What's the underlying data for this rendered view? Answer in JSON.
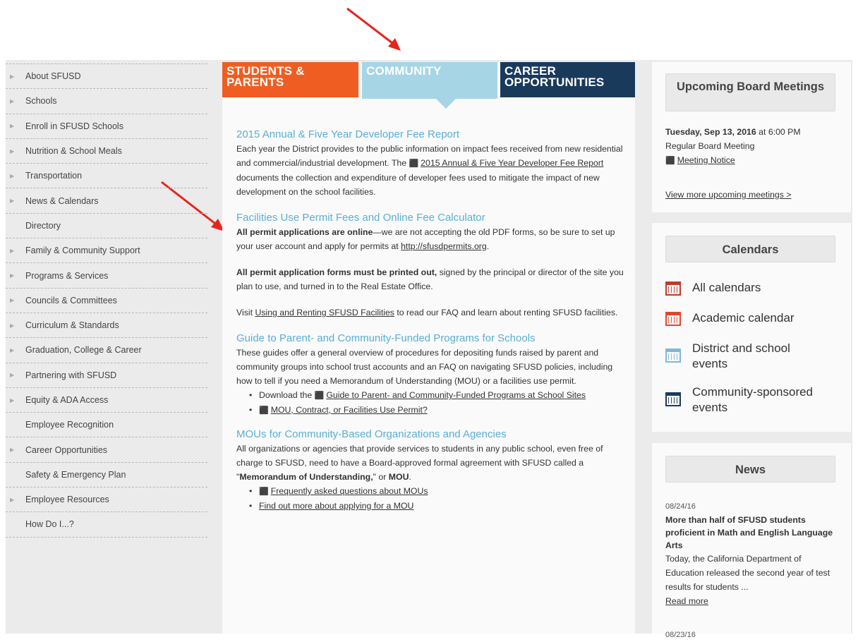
{
  "nav": {
    "items": [
      {
        "label": "About SFUSD",
        "arrow": true
      },
      {
        "label": "Schools",
        "arrow": true
      },
      {
        "label": "Enroll in SFUSD Schools",
        "arrow": true
      },
      {
        "label": "Nutrition & School Meals",
        "arrow": true
      },
      {
        "label": "Transportation",
        "arrow": true
      },
      {
        "label": "News & Calendars",
        "arrow": true
      },
      {
        "label": "Directory",
        "arrow": false
      },
      {
        "label": "Family & Community Support",
        "arrow": true
      },
      {
        "label": "Programs & Services",
        "arrow": true
      },
      {
        "label": "Councils & Committees",
        "arrow": true
      },
      {
        "label": "Curriculum & Standards",
        "arrow": true
      },
      {
        "label": "Graduation, College & Career",
        "arrow": true
      },
      {
        "label": "Partnering with SFUSD",
        "arrow": true
      },
      {
        "label": "Equity & ADA Access",
        "arrow": true
      },
      {
        "label": "Employee Recognition",
        "arrow": false
      },
      {
        "label": "Career Opportunities",
        "arrow": true
      },
      {
        "label": "Safety & Emergency Plan",
        "arrow": false
      },
      {
        "label": "Employee Resources",
        "arrow": true
      },
      {
        "label": "How Do I...?",
        "arrow": false
      }
    ]
  },
  "tabs": {
    "students_line1": "STUDENTS &",
    "students_line2": "PARENTS",
    "community": "COMMUNITY",
    "career_line1": "CAREER",
    "career_line2": "OPPORTUNITIES"
  },
  "content": {
    "s1_title": "2015 Annual & Five Year Developer Fee Report",
    "s1_t1": "Each year the District provides to the public information on impact fees received from new residential and commercial/industrial development. The ",
    "s1_link": "2015 Annual & Five Year Developer Fee Report",
    "s1_t2": " documents the collection and expenditure of developer fees used to mitigate the impact of new development on the school facilities.",
    "s2_title": "Facilities Use Permit Fees and Online Fee Calculator",
    "s2_p1_bold": "All permit applications are online",
    "s2_p1_text": "—we are not accepting the old PDF forms, so be sure to set up your user account and apply for permits at ",
    "s2_p1_link": "http://sfusdpermits.org",
    "s2_p1_end": ".",
    "s2_p2_bold": "All permit application forms must be printed out,",
    "s2_p2_text": " signed by the principal or director of the site you plan to use, and turned in to the Real Estate Office.",
    "s2_p3_a": "Visit ",
    "s2_p3_link": "Using and Renting SFUSD Facilities",
    "s2_p3_b": " to read our FAQ and learn about renting SFUSD facilities.",
    "s3_title": "Guide to Parent- and Community-Funded Programs for Schools",
    "s3_text": "These guides offer a general overview of procedures for depositing funds raised by parent and community groups into school trust accounts and an FAQ on navigating SFUSD policies, including how to tell if you need a Memorandum of Understanding (MOU) or a facilities use permit.",
    "s3_b1_pre": "Download the ",
    "s3_b1_link": "Guide to Parent- and Community-Funded Programs at School Sites",
    "s3_b2_link": "MOU, Contract, or Facilities Use Permit?",
    "s4_title": "MOUs for Community-Based Organizations and Agencies",
    "s4_t1": "All organizations or agencies that provide services to students in any public school, even free of charge to SFUSD, need to have a Board-approved formal agreement with SFUSD called a \"",
    "s4_b1": "Memorandum of Understanding,",
    "s4_t2": "\" or ",
    "s4_b2": "MOU",
    "s4_t3": ".",
    "s4_l1": "Frequently asked questions about MOUs",
    "s4_l2": "Find out more about applying for a MOU"
  },
  "board": {
    "title": "Upcoming Board Meetings",
    "date_bold": "Tuesday, Sep 13, 2016",
    "time": " at 6:00 PM",
    "type": "Regular Board Meeting",
    "notice": "Meeting Notice",
    "more": "View more upcoming meetings >"
  },
  "calendars": {
    "title": "Calendars",
    "items": [
      {
        "label": "All calendars",
        "color": "#c0392b"
      },
      {
        "label": "Academic calendar",
        "color": "#e2462f"
      },
      {
        "label": "District and school events",
        "color": "#7fb8d8"
      },
      {
        "label": "Community-sponsored events",
        "color": "#1a3a5c"
      }
    ]
  },
  "news": {
    "title": "News",
    "date1": "08/24/16",
    "headline1": "More than half of SFUSD students proficient in Math and English Language Arts",
    "text1": "Today, the California Department of Education released the second year of test results for students ...",
    "read_more": "Read more",
    "date2": "08/23/16"
  },
  "colors": {
    "orange": "#f05d22",
    "light_blue": "#a6d5e6",
    "navy": "#1a3a5c",
    "link_blue": "#5aaed4",
    "arrow_red": "#e8231c"
  }
}
